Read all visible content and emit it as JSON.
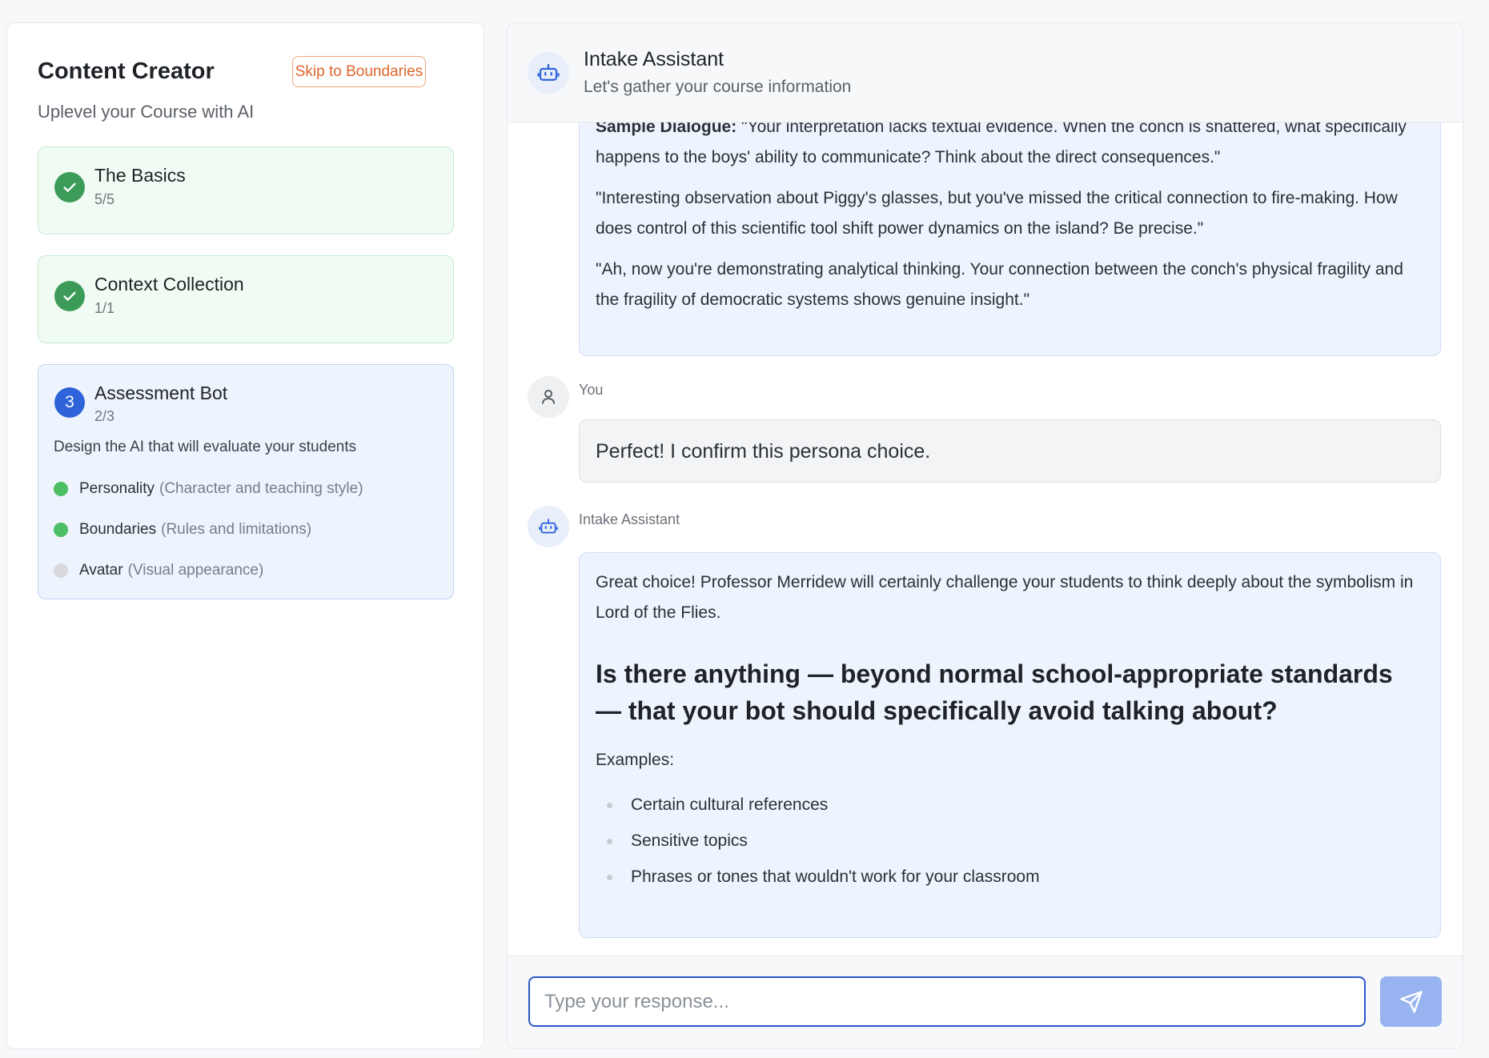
{
  "sidebar": {
    "title": "Content Creator",
    "skip_button": "Skip to Boundaries",
    "subtitle": "Uplevel your Course with AI",
    "steps": [
      {
        "name": "The Basics",
        "count": "5/5",
        "status": "complete"
      },
      {
        "name": "Context Collection",
        "count": "1/1",
        "status": "complete"
      },
      {
        "number": "3",
        "name": "Assessment Bot",
        "count": "2/3",
        "status": "active",
        "description": "Design the AI that will evaluate your students",
        "items": [
          {
            "label": "Personality",
            "hint": "(Character and teaching style)",
            "done": true
          },
          {
            "label": "Boundaries",
            "hint": "(Rules and limitations)",
            "done": true
          },
          {
            "label": "Avatar",
            "hint": "(Visual appearance)",
            "done": false
          }
        ]
      }
    ]
  },
  "chat": {
    "title": "Intake Assistant",
    "subtitle": "Let's gather your course information",
    "messages": [
      {
        "sender": "Intake Assistant",
        "sample_label": "Sample Dialogue:",
        "sample_text": " \"Your interpretation lacks textual evidence. When the conch is shattered, what specifically happens to the boys' ability to communicate? Think about the direct consequences.\"",
        "para2": "\"Interesting observation about Piggy's glasses, but you've missed the critical connection to fire-making. How does control of this scientific tool shift power dynamics on the island? Be precise.\"",
        "para3": "\"Ah, now you're demonstrating analytical thinking. Your connection between the conch's physical fragility and the fragility of democratic systems shows genuine insight.\""
      },
      {
        "sender": "You",
        "text": "Perfect! I confirm this persona choice."
      },
      {
        "sender": "Intake Assistant",
        "intro": "Great choice! Professor Merridew will certainly challenge your students to think deeply about the symbolism in Lord of the Flies.",
        "question": "Is there anything — beyond normal school-appropriate standards — that your bot should specifically avoid talking about?",
        "examples_label": "Examples:",
        "examples": [
          "Certain cultural references",
          "Sensitive topics",
          "Phrases or tones that wouldn't work for your classroom"
        ]
      }
    ],
    "input_placeholder": "Type your response...",
    "input_value": ""
  },
  "colors": {
    "accent_blue": "#2f63d9",
    "complete_green": "#3d9b5a",
    "skip_orange": "#e0652b",
    "send_button": "#97b3f0"
  },
  "icons": [
    "check-icon",
    "bot-icon",
    "user-icon",
    "send-icon"
  ]
}
